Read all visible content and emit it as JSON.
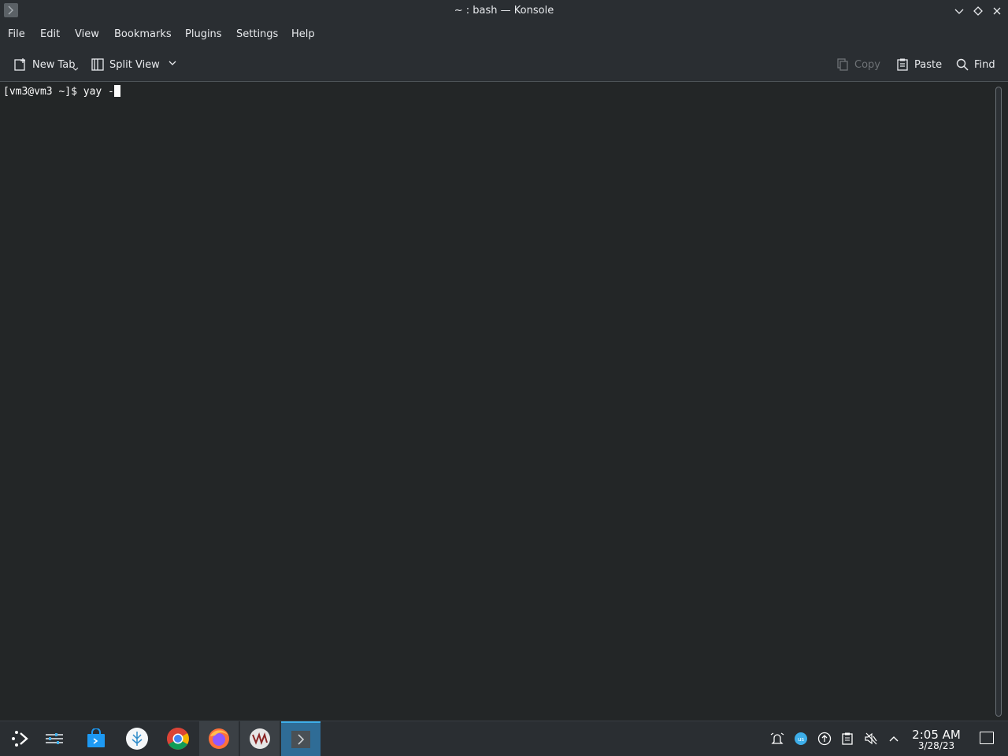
{
  "window": {
    "title": "~ : bash — Konsole",
    "buttons": [
      "minimize",
      "maximize",
      "close"
    ]
  },
  "menubar": {
    "items": [
      "File",
      "Edit",
      "View",
      "Bookmarks",
      "Plugins",
      "Settings",
      "Help"
    ]
  },
  "toolbar": {
    "new_tab": "New Tab",
    "split_view": "Split View",
    "copy": "Copy",
    "paste": "Paste",
    "find": "Find"
  },
  "terminal": {
    "prompt": "[vm3@vm3 ~]$ ",
    "command": "yay -"
  },
  "taskbar": {
    "apps": [
      {
        "icon": "app-launcher-icon"
      },
      {
        "icon": "system-settings-icon"
      },
      {
        "icon": "discover-store-icon"
      },
      {
        "icon": "app-icon-white-circle"
      },
      {
        "icon": "chrome-icon"
      },
      {
        "icon": "firefox-icon"
      },
      {
        "icon": "vm-app-icon"
      },
      {
        "icon": "konsole-icon"
      }
    ],
    "clock_time": "2:05 AM",
    "clock_date": "3/28/23"
  },
  "colors": {
    "background": "#232627",
    "chrome": "#2a2e32",
    "accent": "#3daee9"
  }
}
